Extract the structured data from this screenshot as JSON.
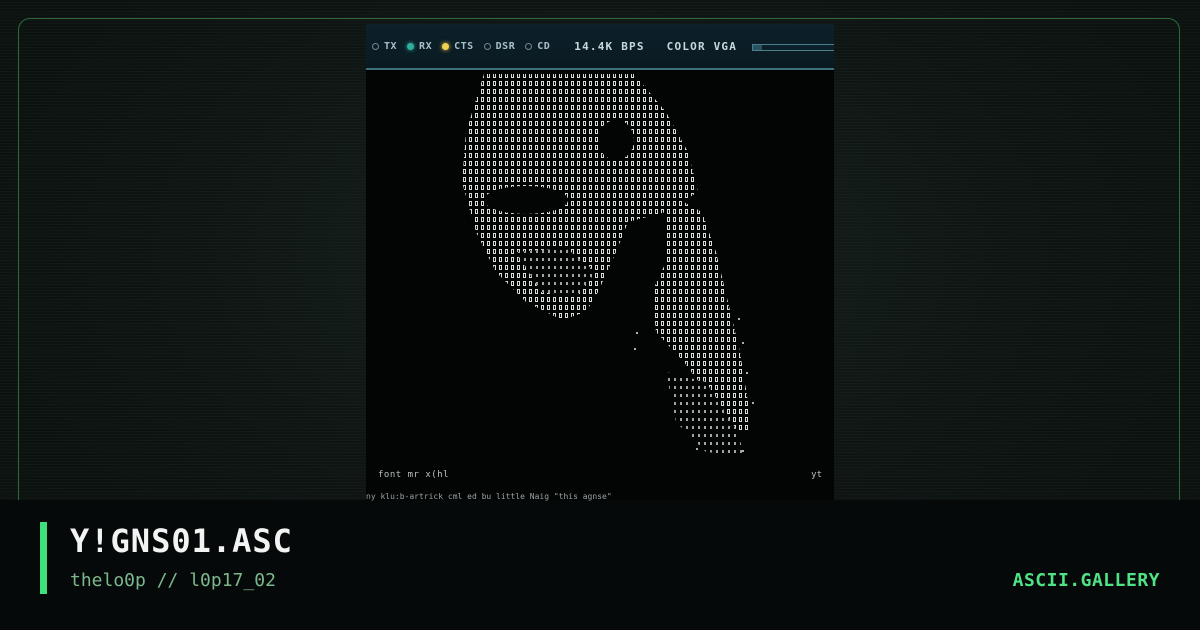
{
  "status_bar": {
    "indicators": [
      {
        "label": "TX",
        "state": "off"
      },
      {
        "label": "RX",
        "state": "green"
      },
      {
        "label": "CTS",
        "state": "yellow"
      },
      {
        "label": "DSR",
        "state": "off"
      },
      {
        "label": "CD",
        "state": "off"
      }
    ],
    "bps": "14.4K BPS",
    "mode": "COLOR VGA",
    "progress_fraction": 0.1
  },
  "artwork": {
    "caption_left": "font mr x(hl",
    "caption_right": "yt",
    "credit": "ny klu:b-artrick  cml ed bu little Naig \"this agnse\""
  },
  "info": {
    "title": "Y!GNS01.ASC",
    "subtitle": "thelo0p // l0p17_02",
    "brand": "ASCII.GALLERY"
  },
  "colors": {
    "accent": "#3ee07a",
    "frame_border": "#2f6a3d",
    "led_green": "#2fb0a0",
    "led_yellow": "#f0d050"
  }
}
